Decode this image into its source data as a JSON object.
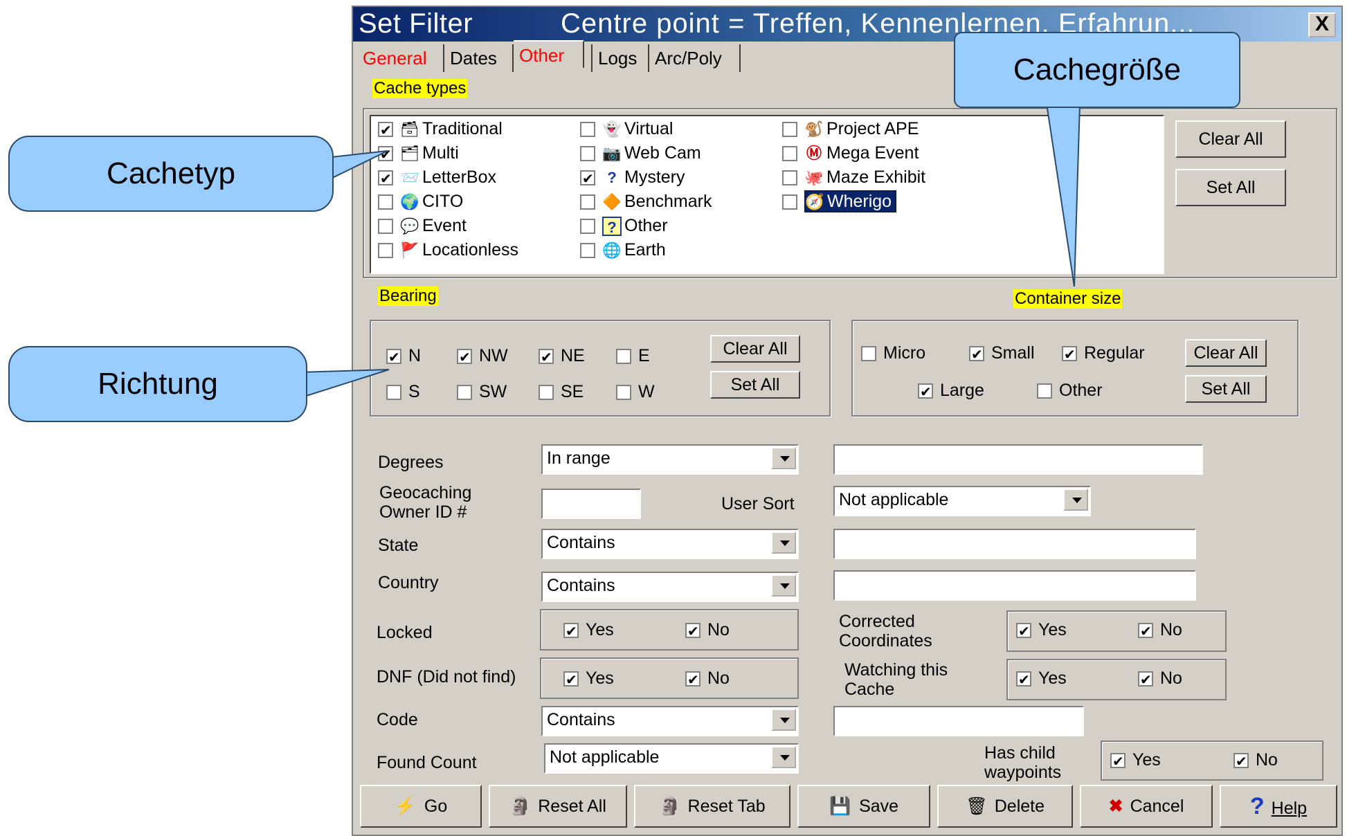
{
  "window": {
    "title": "Set Filter",
    "title_centre": "Centre point = Treffen, Kennenlernen, Erfahrun...",
    "close_label": "X"
  },
  "tabs": [
    {
      "label": "General",
      "color": "#ff0000"
    },
    {
      "label": "Dates",
      "color": "#000000"
    },
    {
      "label": "Other",
      "color": "#ff0000"
    },
    {
      "label": "Logs",
      "color": "#000000"
    },
    {
      "label": "Arc/Poly",
      "color": "#000000"
    }
  ],
  "cache_types": {
    "heading": "Cache types",
    "items": [
      {
        "label": "Traditional",
        "checked": true,
        "icon": "traditional-icon"
      },
      {
        "label": "Multi",
        "checked": true,
        "icon": "multi-icon"
      },
      {
        "label": "LetterBox",
        "checked": true,
        "icon": "letterbox-icon"
      },
      {
        "label": "CITO",
        "checked": false,
        "icon": "cito-icon"
      },
      {
        "label": "Event",
        "checked": false,
        "icon": "event-icon"
      },
      {
        "label": "Locationless",
        "checked": false,
        "icon": "locationless-icon"
      },
      {
        "label": "Virtual",
        "checked": false,
        "icon": "virtual-icon"
      },
      {
        "label": "Web Cam",
        "checked": false,
        "icon": "webcam-icon"
      },
      {
        "label": "Mystery",
        "checked": true,
        "icon": "mystery-icon"
      },
      {
        "label": "Benchmark",
        "checked": false,
        "icon": "benchmark-icon"
      },
      {
        "label": "Other",
        "checked": false,
        "icon": "other-icon"
      },
      {
        "label": "Earth",
        "checked": false,
        "icon": "earth-icon"
      },
      {
        "label": "Project APE",
        "checked": false,
        "icon": "project-ape-icon"
      },
      {
        "label": "Mega Event",
        "checked": false,
        "icon": "mega-event-icon"
      },
      {
        "label": "Maze Exhibit",
        "checked": false,
        "icon": "maze-exhibit-icon"
      },
      {
        "label": "Wherigo",
        "checked": false,
        "icon": "wherigo-icon"
      }
    ],
    "clear_all": "Clear All",
    "set_all": "Set All"
  },
  "bearing": {
    "heading": "Bearing",
    "items": [
      {
        "label": "N",
        "checked": true
      },
      {
        "label": "NW",
        "checked": true
      },
      {
        "label": "NE",
        "checked": true
      },
      {
        "label": "E",
        "checked": false
      },
      {
        "label": "S",
        "checked": false
      },
      {
        "label": "SW",
        "checked": false
      },
      {
        "label": "SE",
        "checked": false
      },
      {
        "label": "W",
        "checked": false
      }
    ],
    "clear_all": "Clear All",
    "set_all": "Set All"
  },
  "container_size": {
    "heading": "Container size",
    "items": [
      {
        "label": "Micro",
        "checked": false
      },
      {
        "label": "Small",
        "checked": true
      },
      {
        "label": "Regular",
        "checked": true
      },
      {
        "label": "Large",
        "checked": true
      },
      {
        "label": "Other",
        "checked": false
      }
    ],
    "clear_all": "Clear All",
    "set_all": "Set All"
  },
  "fields": {
    "degrees_label": "Degrees",
    "degrees_combo": "In range",
    "degrees_value": "",
    "owner_label_1": "Geocaching",
    "owner_label_2": "Owner ID #",
    "owner_value": "",
    "user_sort_label": "User Sort",
    "user_sort_combo": "Not applicable",
    "state_label": "State",
    "state_combo": "Contains",
    "state_value": "",
    "country_label": "Country",
    "country_combo": "Contains",
    "country_value": "",
    "locked_label": "Locked",
    "dnf_label": "DNF (Did not find)",
    "corrected_label_1": "Corrected",
    "corrected_label_2": "Coordinates",
    "watching_label_1": "Watching this",
    "watching_label_2": "Cache",
    "code_label": "Code",
    "code_combo": "Contains",
    "code_value": "",
    "found_count_label": "Found Count",
    "found_count_combo": "Not applicable",
    "child_label_1": "Has child",
    "child_label_2": "waypoints",
    "yes": "Yes",
    "no": "No"
  },
  "buttons": {
    "go": "Go",
    "reset_all": "Reset All",
    "reset_tab": "Reset Tab",
    "save": "Save",
    "delete": "Delete",
    "cancel": "Cancel",
    "help": "Help"
  },
  "callouts": {
    "cachetyp": "Cachetyp",
    "richtung": "Richtung",
    "cachegroesse": "Cachegröße"
  },
  "colors": {
    "callout_fill": "#99ccff",
    "highlight": "#ffff00",
    "dialog_bg": "#d4d0c8",
    "title_blue": "#0a246a"
  }
}
